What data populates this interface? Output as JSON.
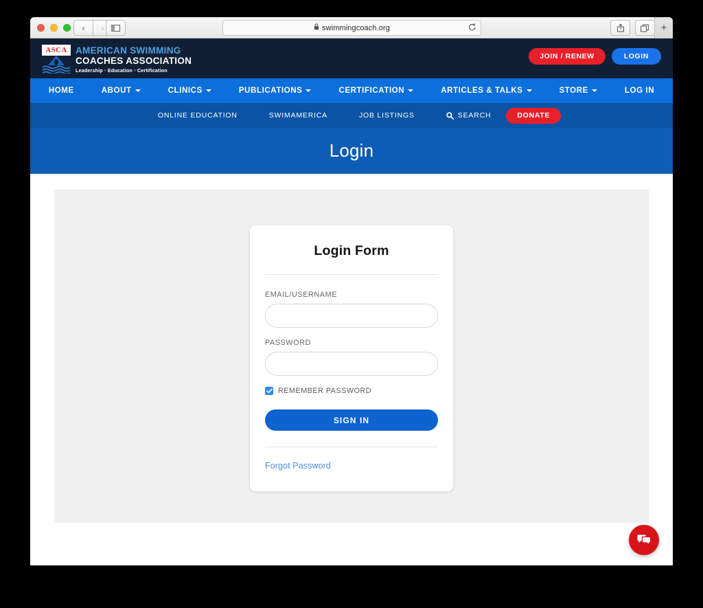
{
  "browser": {
    "url": "swimmingcoach.org",
    "back_label": "‹",
    "forward_label": "›",
    "sidebar_icon": "sidebar-icon",
    "reload_icon": "reload-icon",
    "share_icon": "share-icon",
    "tabs_icon": "tabs-icon",
    "new_tab_label": "+",
    "lock_icon": "lock-icon"
  },
  "site_header": {
    "logo": {
      "badge_text": "ASCA",
      "line1": "AMERICAN SWIMMING",
      "line2": "COACHES ASSOCIATION",
      "tagline_parts": [
        "Leadership",
        "Education",
        "Certification"
      ],
      "tagline_separator": "•"
    },
    "actions": [
      {
        "label": "JOIN / RENEW",
        "color": "#e8202a"
      },
      {
        "label": "LOGIN",
        "color": "#1a73e8"
      }
    ]
  },
  "primary_nav": {
    "background": "#0d6fdb",
    "items": [
      {
        "label": "HOME",
        "has_dropdown": false
      },
      {
        "label": "ABOUT",
        "has_dropdown": true
      },
      {
        "label": "CLINICS",
        "has_dropdown": true
      },
      {
        "label": "PUBLICATIONS",
        "has_dropdown": true
      },
      {
        "label": "CERTIFICATION",
        "has_dropdown": true
      },
      {
        "label": "ARTICLES & TALKS",
        "has_dropdown": true
      },
      {
        "label": "STORE",
        "has_dropdown": true
      },
      {
        "label": "LOG IN",
        "has_dropdown": false
      }
    ]
  },
  "secondary_nav": {
    "background": "#0b53a5",
    "items": [
      {
        "label": "ONLINE EDUCATION"
      },
      {
        "label": "SWIMAMERICA"
      },
      {
        "label": "JOB LISTINGS"
      },
      {
        "label": "SEARCH",
        "icon": "search-icon"
      }
    ],
    "donate_label": "DONATE",
    "donate_color": "#e8202a"
  },
  "page_banner": {
    "title": "Login",
    "background": "#0d5cb6"
  },
  "login_form": {
    "title": "Login Form",
    "email_label": "EMAIL/USERNAME",
    "email_value": "",
    "email_placeholder": "",
    "password_label": "PASSWORD",
    "password_value": "",
    "password_placeholder": "",
    "remember_label": "REMEMBER PASSWORD",
    "remember_checked": true,
    "checkbox_color": "#2b8cf0",
    "submit_label": "SIGN IN",
    "submit_color": "#0d63cf",
    "forgot_label": "Forgot Password",
    "forgot_color": "#4a90e2"
  },
  "chat_widget": {
    "icon": "chat-bubble-icon",
    "color": "#d8131a"
  }
}
